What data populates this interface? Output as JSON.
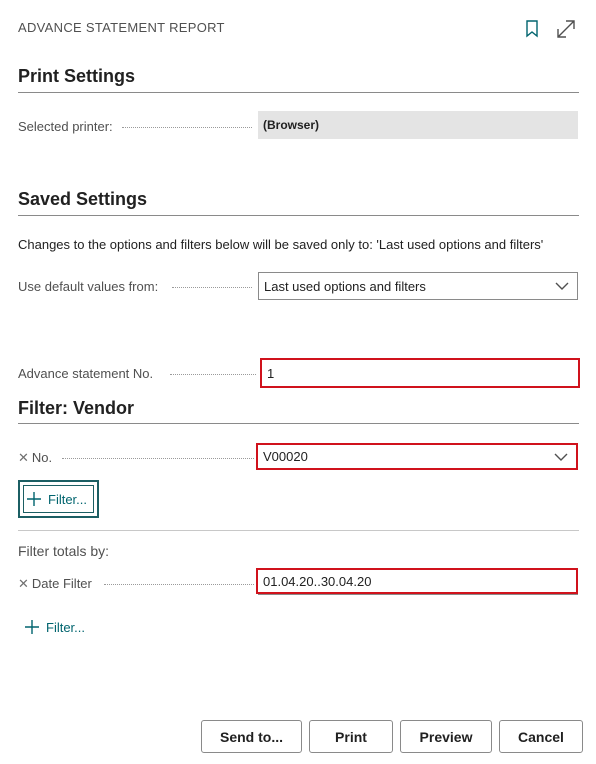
{
  "header": {
    "title": "ADVANCE STATEMENT REPORT",
    "bookmark_icon": "bookmark-icon",
    "expand_icon": "expand-icon"
  },
  "print_settings": {
    "heading": "Print Settings",
    "printer_label": "Selected printer:",
    "printer_value": "(Browser)"
  },
  "saved_settings": {
    "heading": "Saved Settings",
    "note": "Changes to the options and filters below will be saved only to: 'Last used options and filters'",
    "default_label": "Use default values from:",
    "default_value": "Last used options and filters"
  },
  "options": {
    "statement_label": "Advance statement No.",
    "statement_value": "1"
  },
  "filter_vendor": {
    "heading": "Filter: Vendor",
    "no_label": "No.",
    "no_value": "V00020",
    "add_filter": "Filter..."
  },
  "filter_totals": {
    "heading": "Filter totals by:",
    "date_label": "Date Filter",
    "date_value": "01.04.20..30.04.20",
    "add_filter": "Filter..."
  },
  "buttons": {
    "send_to": "Send to...",
    "print": "Print",
    "preview": "Preview",
    "cancel": "Cancel"
  },
  "colors": {
    "accent": "#00646e",
    "highlight": "#d0121c"
  }
}
